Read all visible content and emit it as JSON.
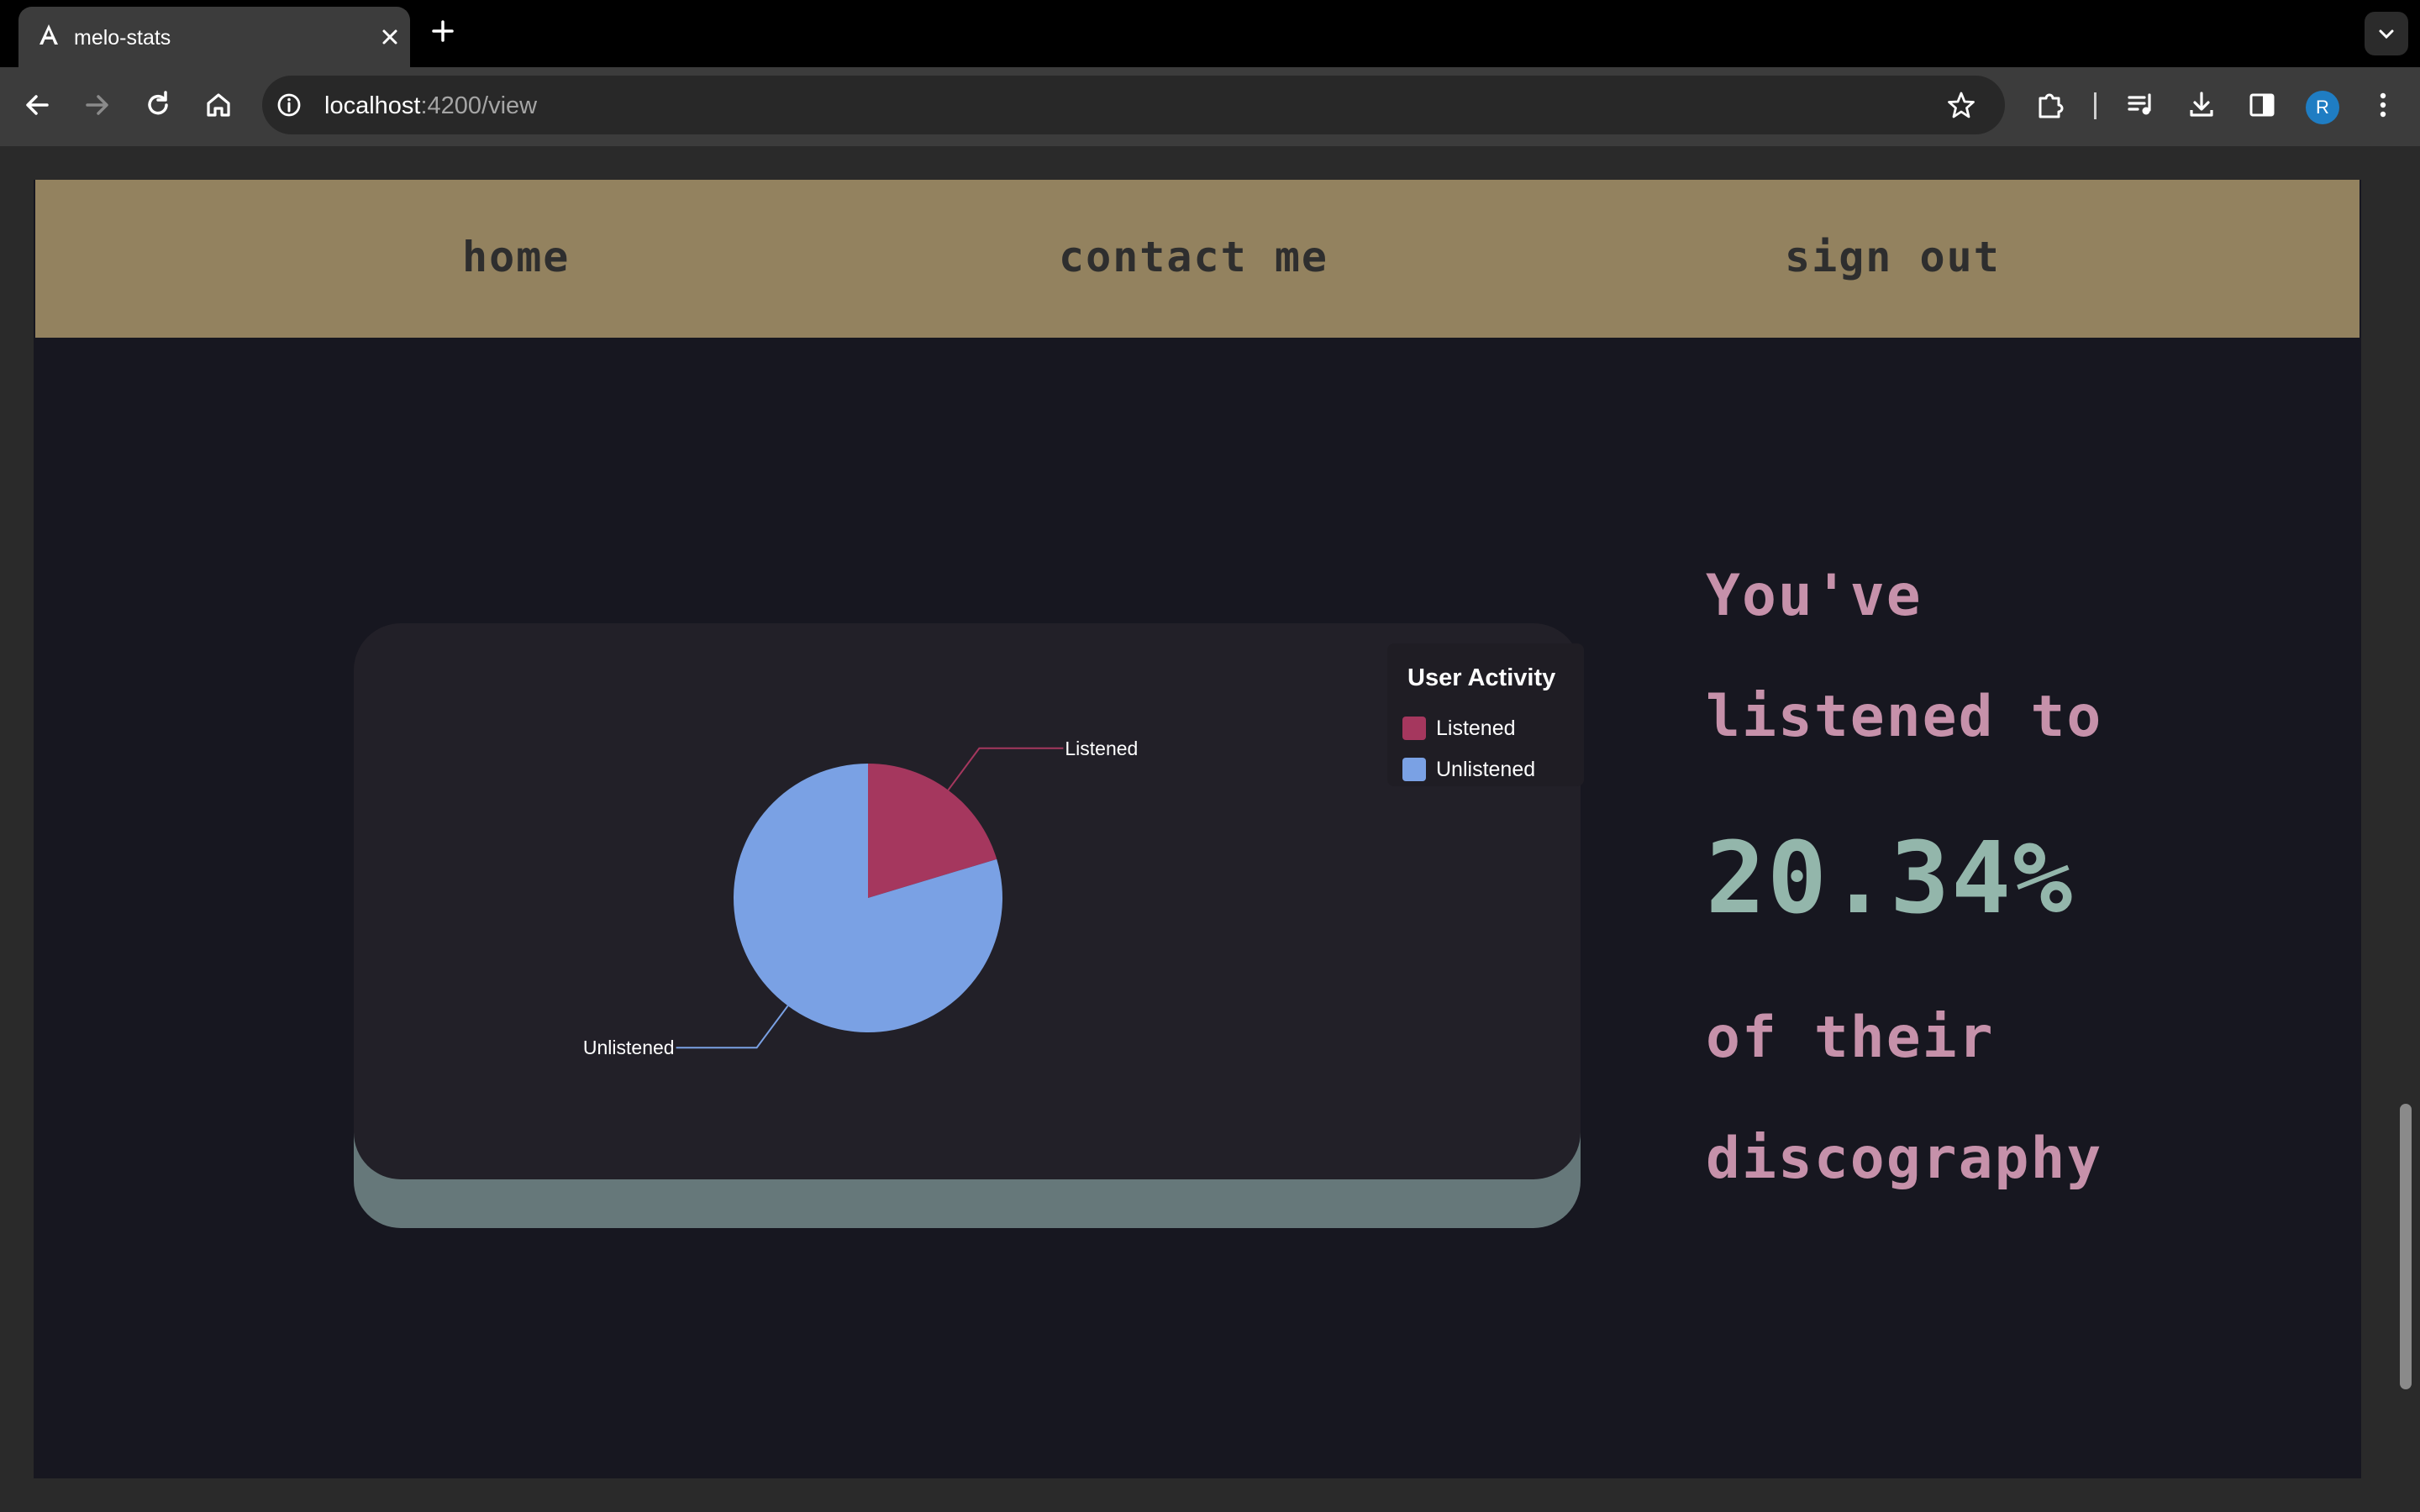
{
  "browser": {
    "tab_title": "melo-stats",
    "url_host": "localhost",
    "url_path": ":4200/view",
    "profile_initial": "R"
  },
  "nav": {
    "home": "home",
    "contact": "contact me",
    "signout": "sign out"
  },
  "chart_data": {
    "type": "pie",
    "title": "",
    "legend_title": "User Activity",
    "legend_position": "top-right",
    "labels": [
      "Listened",
      "Unlistened"
    ],
    "values": [
      20.34,
      79.66
    ],
    "colors": [
      "#a5375e",
      "#7aa1e4"
    ]
  },
  "stats": {
    "line1": "You've",
    "line2": "listened to",
    "percent": "20.34%",
    "line3": "of their",
    "line4": "discography"
  },
  "colors": {
    "navbar": "#93825f",
    "page_bg": "#171720",
    "card_bg": "#222028",
    "card_shadow": "#66787a",
    "text_pink": "#c691aa",
    "text_green": "#93b6ab"
  }
}
